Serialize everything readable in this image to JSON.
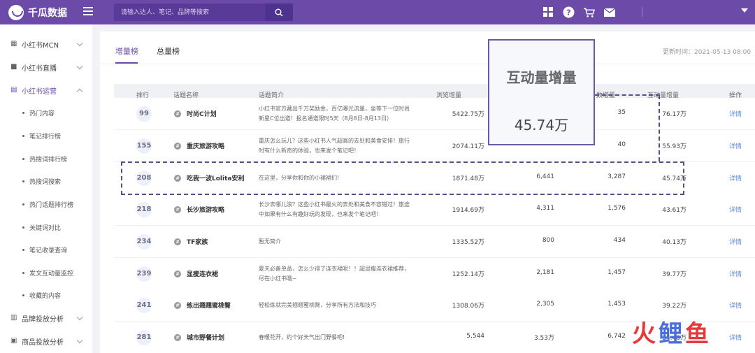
{
  "brand": {
    "name": "千瓜数据"
  },
  "search": {
    "placeholder": "请输入达人、笔记、品牌等搜索"
  },
  "sidebar": {
    "items": [
      {
        "label": "小红书MCN",
        "icon": "grid-icon"
      },
      {
        "label": "小红书直播",
        "icon": "video-icon"
      },
      {
        "label": "小红书运营",
        "icon": "book-icon"
      }
    ],
    "sub_items": [
      "热门内容",
      "笔记排行榜",
      "热搜词排行榜",
      "热搜词搜索",
      "热门话题排行榜",
      "关键词对比",
      "笔记收录查询",
      "发文互动量监控",
      "收藏的内容"
    ],
    "bottom_items": [
      {
        "label": "品牌投放分析",
        "icon": "chart-icon"
      },
      {
        "label": "商品投放分析",
        "icon": "box-icon"
      }
    ]
  },
  "tabs": [
    {
      "label": "增量榜"
    },
    {
      "label": "总量榜"
    }
  ],
  "update_time": "更新时间：2021-05-13 08:00",
  "table": {
    "headers": [
      "排行",
      "话题名称",
      "话题简介",
      "浏览增量",
      "数增量",
      "互动量增量",
      "操作"
    ],
    "detail_label": "详情",
    "rows": [
      {
        "rank": "99",
        "name": "时尚C计划",
        "desc": "小红书官方藏出千万奖励金，百亿曝光流量，坐等下一位时尚新星C位出道！报名通道限时5天（8月8日-8月13日）",
        "views": "5422.75万",
        "col5": "",
        "col6": "35",
        "inter": "76.17万"
      },
      {
        "rank": "155",
        "name": "重庆旅游攻略",
        "desc": "重庆怎么玩儿？这些小红书人气超高的去处和美食安排！旅行时有什么新奇的体验，也来发个笔记吧！",
        "views": "2074.11万",
        "col5": "",
        "col6": "40",
        "inter": "55.93万"
      },
      {
        "rank": "208",
        "name": "吃我一波Lolita安利",
        "desc": "在这里，分享你和你的小裙裙们!",
        "views": "1871.48万",
        "col5": "6,441",
        "col6": "3,287",
        "inter": "45.74万"
      },
      {
        "rank": "218",
        "name": "长沙旅游攻略",
        "desc": "长沙去哪儿浪？这些小红书最火的去处和美食不容错过！旅途中如果有什么有趣好玩的发现，也来发个笔记吧！",
        "views": "1914.69万",
        "col5": "4,311",
        "col6": "1,576",
        "inter": "43.61万"
      },
      {
        "rank": "234",
        "name": "TF家族",
        "desc": "暂无简介",
        "views": "1335.52万",
        "col5": "800",
        "col6": "434",
        "inter": "40.13万"
      },
      {
        "rank": "239",
        "name": "显瘦连衣裙",
        "desc": "夏天必备单品，怎么少得了连衣裙呢！！超显瘦连衣裙推荐，尽在小红书哦~",
        "views": "1252.14万",
        "col5": "2,181",
        "col6": "1,457",
        "inter": "39.77万"
      },
      {
        "rank": "241",
        "name": "练出翘翘蜜桃臀",
        "desc": "轻松练就完美翘翘蜜桃臀，分享所有方法和技巧",
        "views": "1308.06万",
        "col5": "2,305",
        "col6": "1,453",
        "inter": "39.22万"
      },
      {
        "rank": "281",
        "name": "城市野餐计划",
        "desc": "春暖花开，约个好天气出门野餐吧!",
        "views": "5,544",
        "col5": "3.53万",
        "col6": "6,742",
        "inter": "34.46万"
      }
    ]
  },
  "callout": {
    "title": "互动量增量",
    "value": "45.74万"
  },
  "watermark": {
    "chars": [
      "火",
      "鲤",
      "鱼"
    ],
    "colors": [
      "#e8393a",
      "#4a6fd8",
      "#e8393a"
    ]
  },
  "colors": {
    "brand": "#6b4aa8",
    "link": "#5b8ad8"
  }
}
